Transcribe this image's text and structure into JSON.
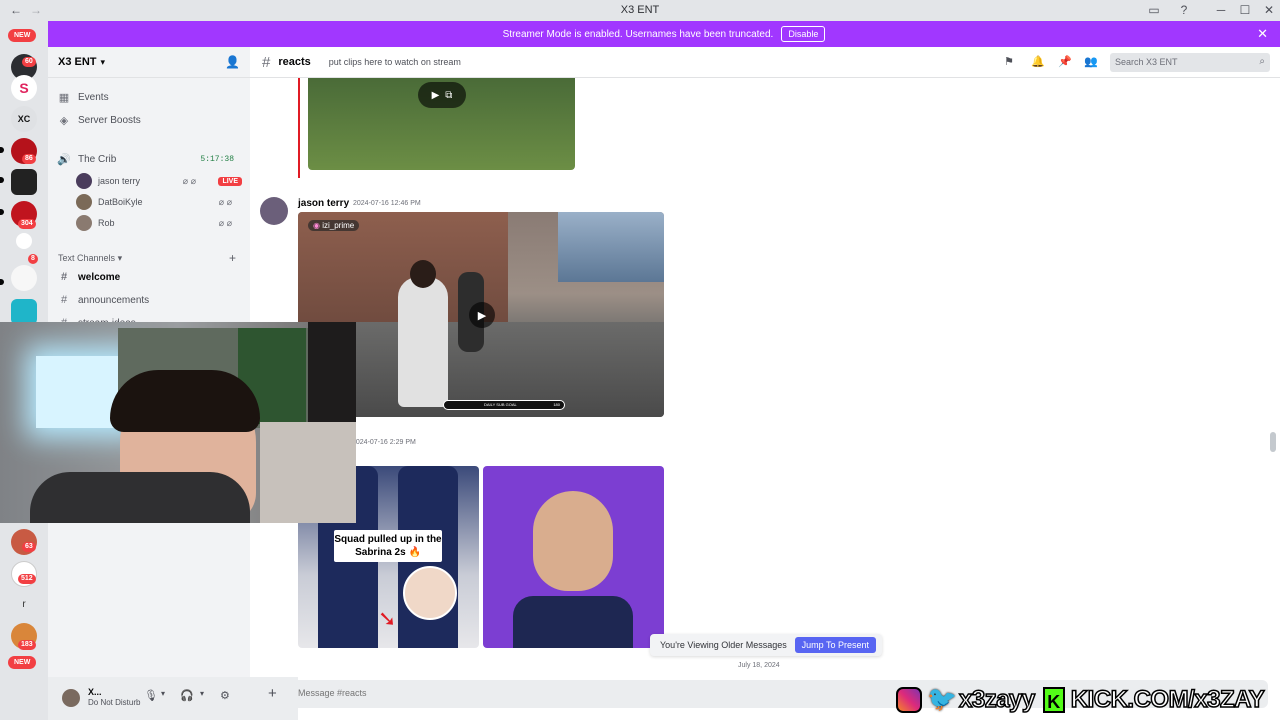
{
  "window": {
    "title": "X3 ENT"
  },
  "banner": {
    "message": "Streamer Mode is enabled. Usernames have been truncated.",
    "disable_label": "Disable"
  },
  "rail": {
    "new_top": "NEW",
    "badge_60": "60",
    "badge_86": "86",
    "badge_8": "8",
    "badge_304": "304",
    "badge_63": "63",
    "badge_512": "512",
    "badge_183": "183",
    "new_bottom": "NEW",
    "xc_label": "XC",
    "r_label": "r"
  },
  "server": {
    "name": "X3 ENT"
  },
  "sidebar": {
    "events": "Events",
    "boosts": "Server Boosts",
    "voice_channel": "The Crib",
    "voice_time": "5:17:38",
    "voice_users": [
      {
        "name": "jason terry",
        "live": "LIVE"
      },
      {
        "name": "DatBoiKyle"
      },
      {
        "name": "Rob"
      }
    ],
    "category": "Text Channels",
    "channels": [
      "welcome",
      "announcements",
      "stream-ideas"
    ]
  },
  "user_panel": {
    "name": "X...",
    "status": "Do Not Disturb"
  },
  "channel_header": {
    "name": "reacts",
    "topic": "put clips here to watch on stream",
    "search_placeholder": "Search X3 ENT"
  },
  "messages": [
    {
      "author": "jason terry",
      "time": "2024-07-16 12:46 PM",
      "overlay_user": "izi_prime"
    },
    {
      "time": "2024-07-16 2:29 PM",
      "caption": "Squad pulled up in the Sabrina 2s 🔥"
    }
  ],
  "sub_goal": "DAILY SUB GOAL",
  "sub_goal_value": "180",
  "older_bar": {
    "text": "You're Viewing Older Messages",
    "jump_label": "Jump To Present"
  },
  "date_separator": "July 18, 2024",
  "composer": {
    "placeholder": "Message #reacts"
  },
  "overlay": {
    "handle": "x3zayy",
    "kick_url": "KICK.COM/x3ZAY"
  },
  "colors": {
    "banner": "#a137ff",
    "accent": "#5865f2",
    "live": "#f23f43",
    "kick": "#53fc18"
  }
}
